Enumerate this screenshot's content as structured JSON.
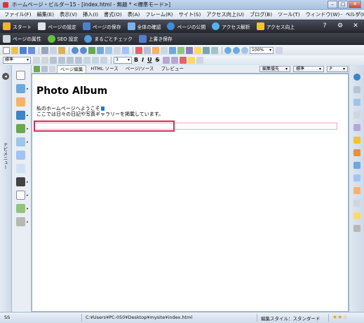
{
  "window": {
    "title": "ホームページ・ビルダー15 - [index.html - 無題 * <標準モード>]",
    "minimize": "–",
    "maximize": "□",
    "close": "✕"
  },
  "menu": {
    "items": [
      "ファイル(F)",
      "編集(E)",
      "表示(V)",
      "挿入(I)",
      "書式(O)",
      "表(A)",
      "フレーム(R)",
      "サイト(S)",
      "アクセス向上(U)",
      "ブログ(B)",
      "ツール(T)",
      "ウィンドウ(W)",
      "ヘルプ(H)"
    ],
    "mdi_min": "–",
    "mdi_restore": "▫",
    "mdi_close": "×"
  },
  "quickbar": {
    "start": "スタート",
    "page_settings": "ページの設定",
    "page_save": "ページの保存",
    "full_check": "全体の確認",
    "page_publish": "ページの公開",
    "access_analysis": "アクセス解析",
    "access_improve": "アクセス向上",
    "help_icon": "?",
    "settings_icon": "⚙",
    "close_icon": "✕"
  },
  "quickbar2": {
    "page_attributes": "ページの属性",
    "seo_settings": "SEO 設定",
    "marugoto_check": "まるごとチェック",
    "overwrite_save": "上書き保存"
  },
  "toolbar": {
    "zoom": "100%",
    "style": "標準",
    "font_size": "3"
  },
  "tabs": {
    "page_edit": "ページ編集",
    "html_source": "HTML ソース",
    "page_source": "ページ/ソース",
    "preview": "プレビュー",
    "edit_priority": "編集優先",
    "standard": "標準",
    "p_tag": "P"
  },
  "left_nav": {
    "label": "ナビメニュー"
  },
  "editor": {
    "heading": "Photo Album",
    "line1": "私のホームページへようこそ",
    "line2": "ここでは日々の日記や写真ギャラリーを掲載しています。"
  },
  "status": {
    "mode": "SS",
    "path": "C:¥Users¥PC-050¥Desktop¥mysite¥index.html",
    "edit_style": "編集スタイル：スタンダード",
    "stars": "★★☆"
  },
  "colors": {
    "highlight": "#d9305a",
    "input_border": "#f7a8c2",
    "quickbar_bg": "#2b2e36"
  }
}
